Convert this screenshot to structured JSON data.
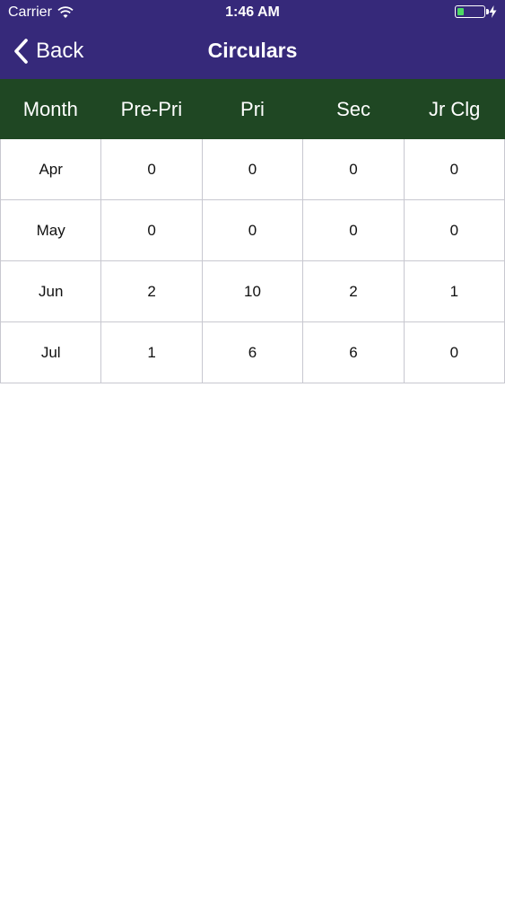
{
  "status_bar": {
    "carrier": "Carrier",
    "time": "1:46 AM",
    "battery_level": 0.25,
    "icons": [
      "wifi-icon",
      "battery-icon",
      "charging-bolt-icon"
    ]
  },
  "nav": {
    "back_label": "Back",
    "title": "Circulars",
    "icons": [
      "chevron-left-icon"
    ]
  },
  "colors": {
    "navbar": "#36297a",
    "table_header": "#1f4723",
    "battery_fill": "#4cd964"
  },
  "table": {
    "headers": [
      "Month",
      "Pre-Pri",
      "Pri",
      "Sec",
      "Jr Clg"
    ],
    "rows": [
      [
        "Apr",
        "0",
        "0",
        "0",
        "0"
      ],
      [
        "May",
        "0",
        "0",
        "0",
        "0"
      ],
      [
        "Jun",
        "2",
        "10",
        "2",
        "1"
      ],
      [
        "Jul",
        "1",
        "6",
        "6",
        "0"
      ]
    ]
  }
}
